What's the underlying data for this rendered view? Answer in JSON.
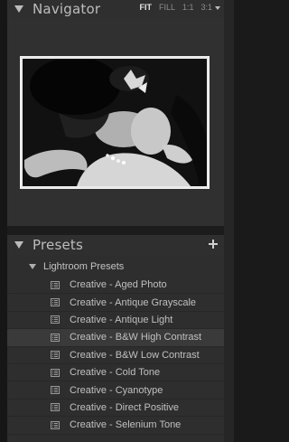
{
  "navigator": {
    "title": "Navigator",
    "zoom_options": [
      {
        "label": "FIT",
        "active": true
      },
      {
        "label": "FILL",
        "active": false
      },
      {
        "label": "1:1",
        "active": false
      },
      {
        "label": "3:1",
        "active": false
      }
    ],
    "preview": {
      "description_icon": "photo-preview",
      "style": "black-and-white"
    }
  },
  "presets": {
    "title": "Presets",
    "add_icon": "plus-icon",
    "folder": {
      "label": "Lightroom Presets",
      "expanded": true
    },
    "items": [
      {
        "label": "Creative - Aged Photo"
      },
      {
        "label": "Creative - Antique Grayscale"
      },
      {
        "label": "Creative - Antique Light"
      },
      {
        "label": "Creative - B&W High Contrast"
      },
      {
        "label": "Creative - B&W Low Contrast"
      },
      {
        "label": "Creative - Cold Tone"
      },
      {
        "label": "Creative - Cyanotype"
      },
      {
        "label": "Creative - Direct Positive"
      },
      {
        "label": "Creative - Selenium Tone"
      }
    ]
  },
  "colors": {
    "panel_bg": "#303030",
    "header_bg": "#2f2f2f",
    "text": "#c0c0c0",
    "active_zoom": "#e6e6e6"
  }
}
